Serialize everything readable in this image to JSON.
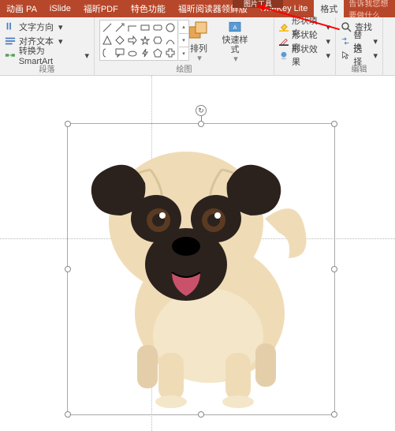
{
  "context_tab_group": "图片工具",
  "tabs": {
    "animation_pa": "动画 PA",
    "islide": "iSlide",
    "foxit_pdf": "福昕PDF",
    "special": "特色功能",
    "foxit_reader": "福昕阅读器领鲜版",
    "onekey": "OneKey Lite",
    "format": "格式"
  },
  "hint_text": "告诉我您想要做什么",
  "ribbon": {
    "text_direction": "文字方向",
    "align_text": "对齐文本",
    "convert_smartart": "转换为 SmartArt",
    "group_paragraph": "段落",
    "arrange": "排列",
    "quick_styles": "快速样式",
    "group_drawing": "绘图",
    "shape_fill": "形状填充",
    "shape_outline": "形状轮廓",
    "shape_effects": "形状效果",
    "find": "查找",
    "replace": "替换",
    "select": "选择",
    "group_edit": "编辑"
  }
}
